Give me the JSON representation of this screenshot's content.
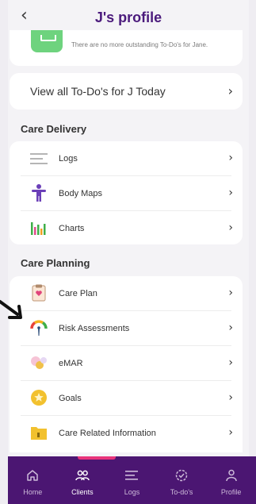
{
  "header": {
    "back_icon": "chevron-left-icon",
    "title": "J's profile"
  },
  "todo": {
    "icon": "todo-icon",
    "text": "There are no more outstanding To-Do's for Jane."
  },
  "view_all": {
    "label": "View all To-Do's for J Today"
  },
  "care_delivery": {
    "title": "Care Delivery",
    "items": [
      {
        "label": "Logs",
        "icon": "logs-icon"
      },
      {
        "label": "Body Maps",
        "icon": "body-map-icon"
      },
      {
        "label": "Charts",
        "icon": "charts-icon"
      }
    ]
  },
  "care_planning": {
    "title": "Care Planning",
    "items": [
      {
        "label": "Care Plan",
        "icon": "care-plan-icon"
      },
      {
        "label": "Risk Assessments",
        "icon": "risk-gauge-icon"
      },
      {
        "label": "eMAR",
        "icon": "pills-icon"
      },
      {
        "label": "Goals",
        "icon": "star-icon"
      },
      {
        "label": "Care Related Information",
        "icon": "folder-icon"
      }
    ]
  },
  "nav": {
    "items": [
      {
        "label": "Home",
        "icon": "home-icon"
      },
      {
        "label": "Clients",
        "icon": "clients-icon",
        "active": true
      },
      {
        "label": "Logs",
        "icon": "logs-icon"
      },
      {
        "label": "To-do's",
        "icon": "todo-check-icon"
      },
      {
        "label": "Profile",
        "icon": "profile-icon"
      }
    ]
  },
  "colors": {
    "brand": "#4b1a7c",
    "nav_bg": "#4b1672",
    "nav_indicator": "#e8337b",
    "todo_green": "#6ed37e"
  }
}
